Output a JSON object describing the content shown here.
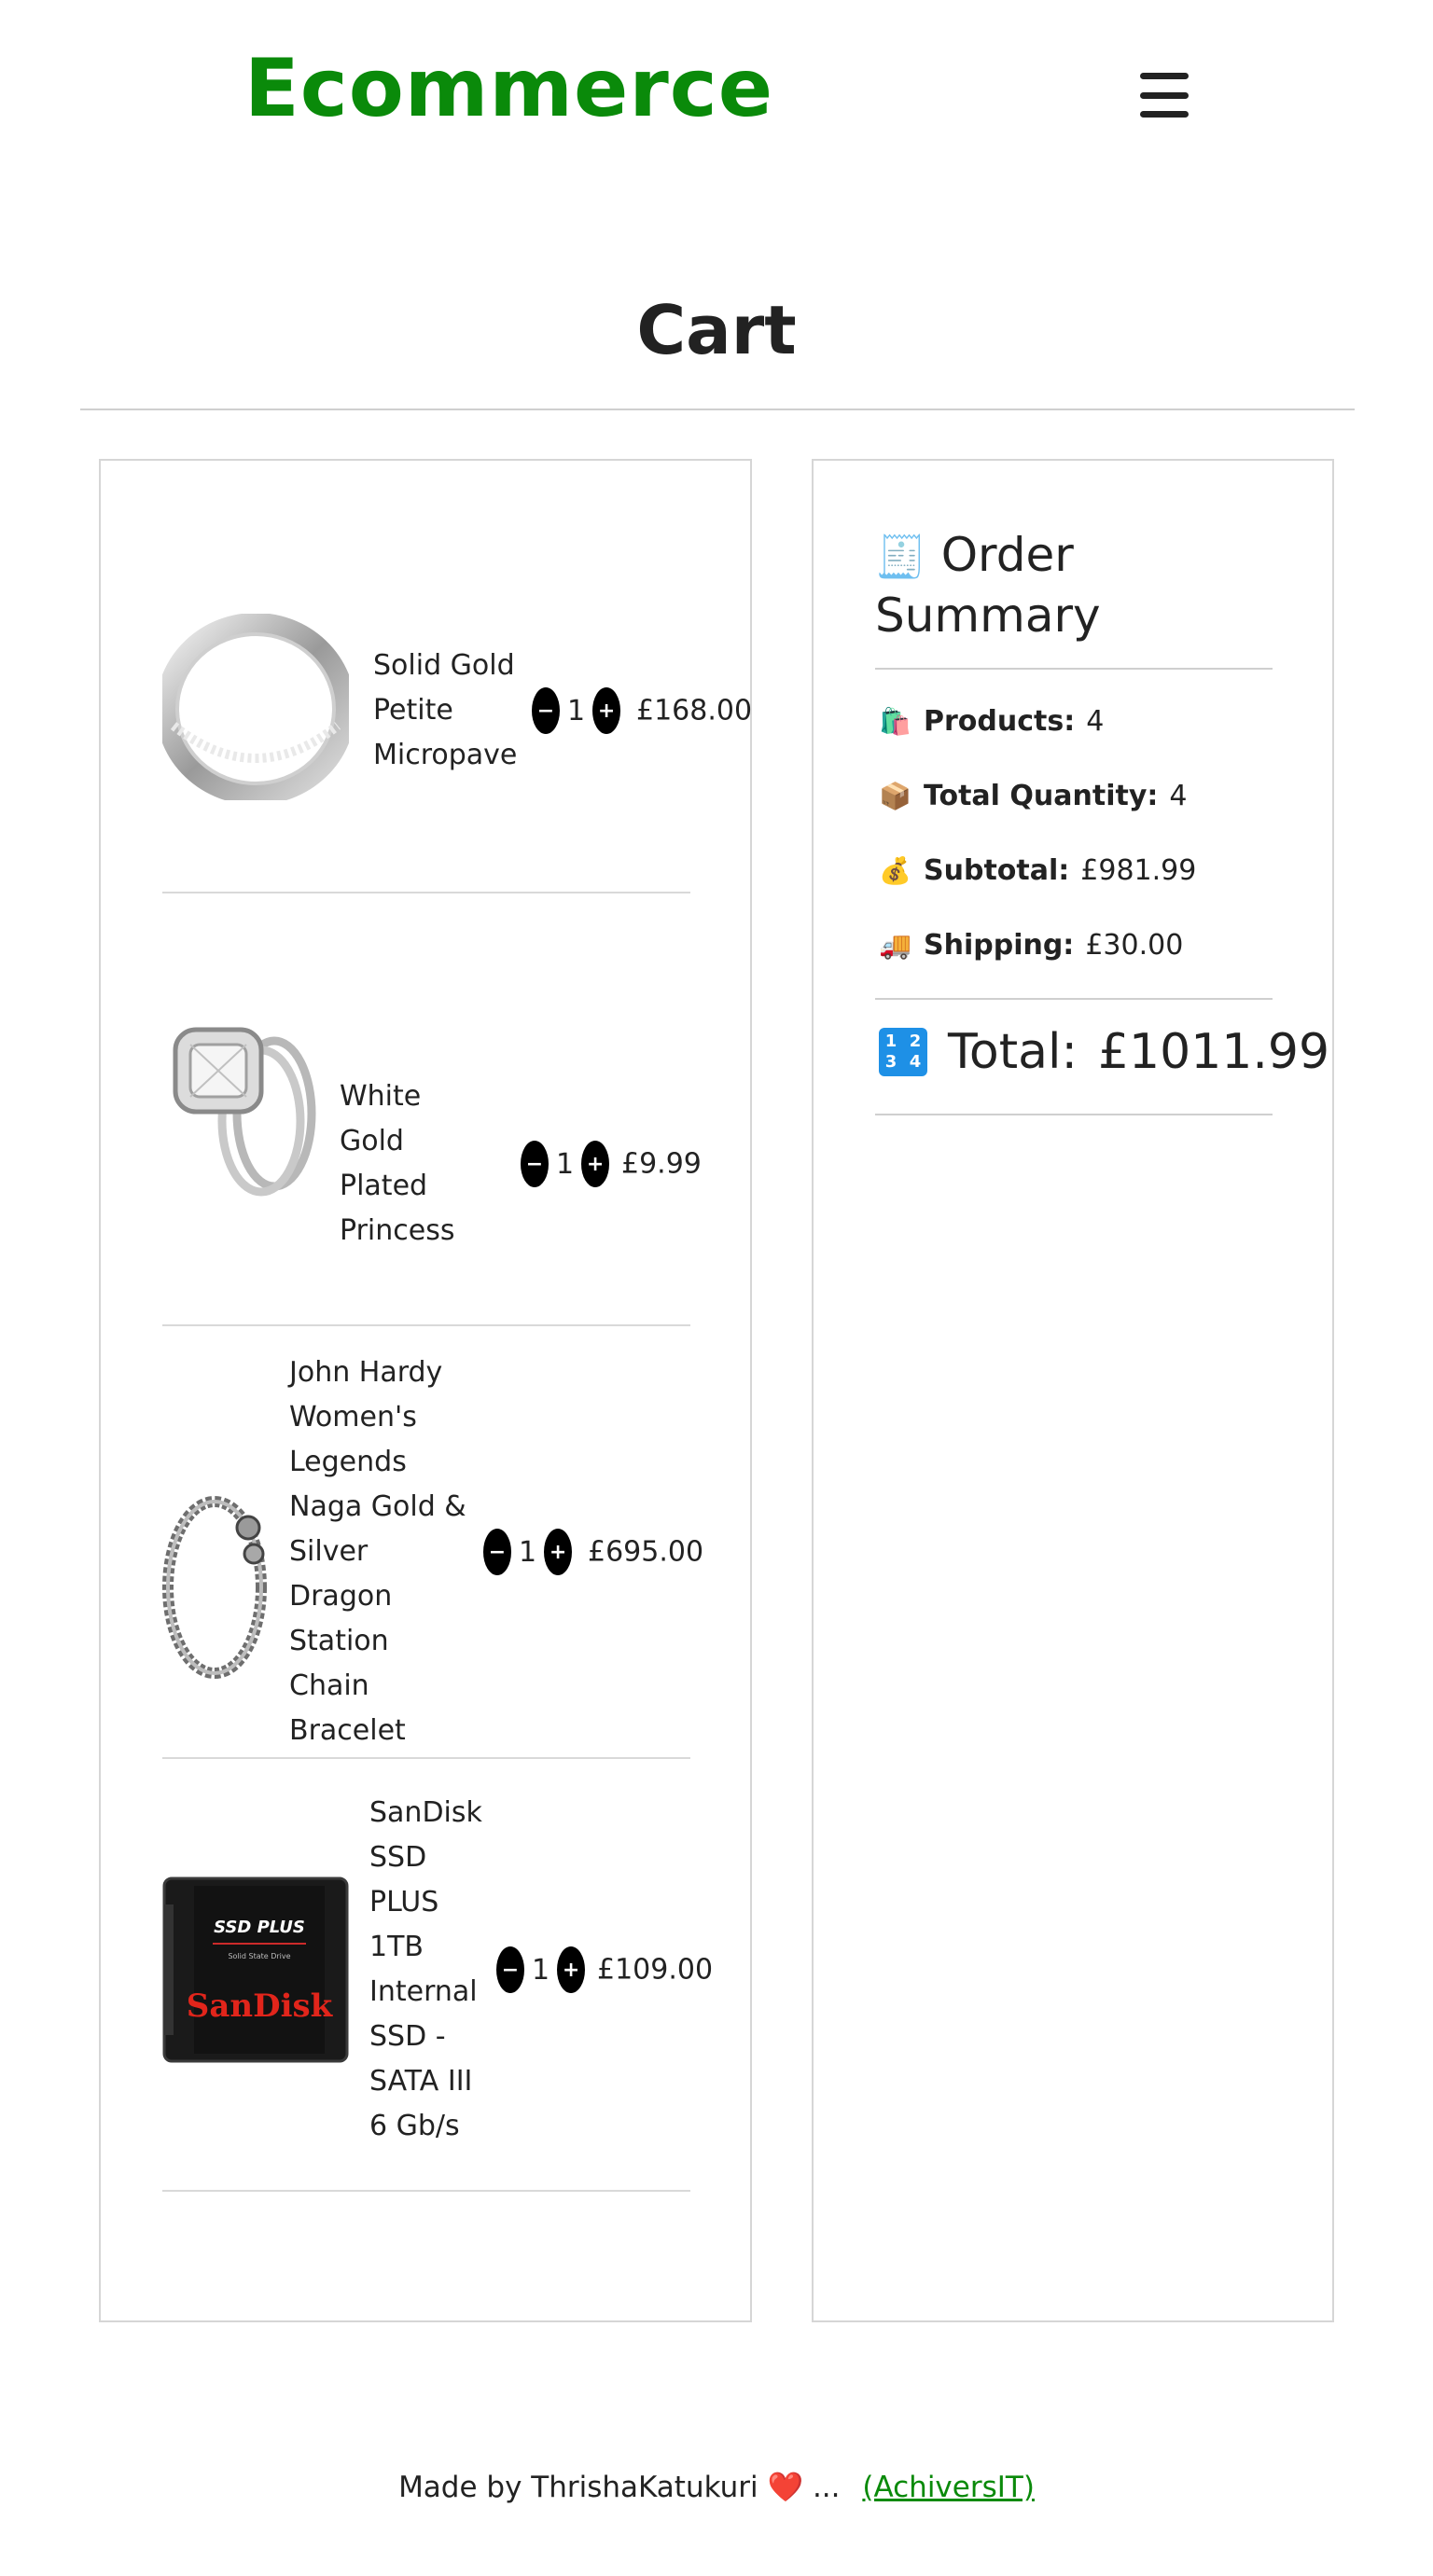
{
  "header": {
    "brand": "Ecommerce",
    "menu_icon": "hamburger-icon"
  },
  "page": {
    "title": "Cart"
  },
  "cart": {
    "items": [
      {
        "name": "Solid Gold Petite Micropave",
        "quantity": "1",
        "price": "£168.00",
        "image": "silver-ring-band"
      },
      {
        "name": "White Gold Plated Princess",
        "quantity": "1",
        "price": "£9.99",
        "image": "diamond-engagement-ring"
      },
      {
        "name": "John Hardy Women's Legends Naga Gold & Silver Dragon Station Chain Bracelet",
        "quantity": "1",
        "price": "£695.00",
        "image": "dragon-chain-bracelet"
      },
      {
        "name": "SanDisk SSD PLUS 1TB Internal SSD - SATA III 6 Gb/s",
        "quantity": "1",
        "price": "£109.00",
        "image": "sandisk-ssd"
      }
    ],
    "minus_label": "−",
    "plus_label": "+"
  },
  "summary": {
    "title_emoji": "🧾",
    "title": "Order Summary",
    "rows": [
      {
        "emoji": "🛍️",
        "label": "Products:",
        "value": "4"
      },
      {
        "emoji": "📦",
        "label": "Total Quantity:",
        "value": "4"
      },
      {
        "emoji": "💰",
        "label": "Subtotal:",
        "value": "£981.99"
      },
      {
        "emoji": "🚚",
        "label": "Shipping:",
        "value": "£30.00"
      }
    ],
    "total_label": "Total:",
    "total_value": "£1011.99",
    "total_badge": [
      "1",
      "2",
      "3",
      "4"
    ]
  },
  "footer": {
    "text": "Made by ThrishaKatukuri",
    "heart": "❤️",
    "ellipsis": "...",
    "link": "(AchiversIT)"
  }
}
